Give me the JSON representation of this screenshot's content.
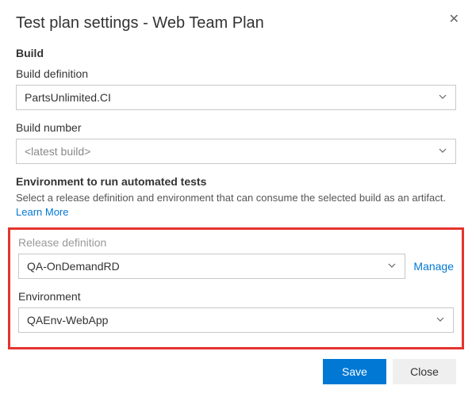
{
  "dialog": {
    "title": "Test plan settings - Web Team Plan",
    "close_glyph": "✕"
  },
  "build": {
    "section_header": "Build",
    "definition_label": "Build definition",
    "definition_value": "PartsUnlimited.CI",
    "number_label": "Build number",
    "number_value": "<latest build>"
  },
  "environment": {
    "section_header": "Environment to run automated tests",
    "helper_text": "Select a release definition and environment that can consume the selected build as an artifact. ",
    "learn_more": "Learn More",
    "release_definition_label": "Release definition",
    "release_definition_value": "QA-OnDemandRD",
    "manage_label": "Manage",
    "environment_label": "Environment",
    "environment_value": "QAEnv-WebApp"
  },
  "buttons": {
    "save": "Save",
    "close": "Close"
  }
}
